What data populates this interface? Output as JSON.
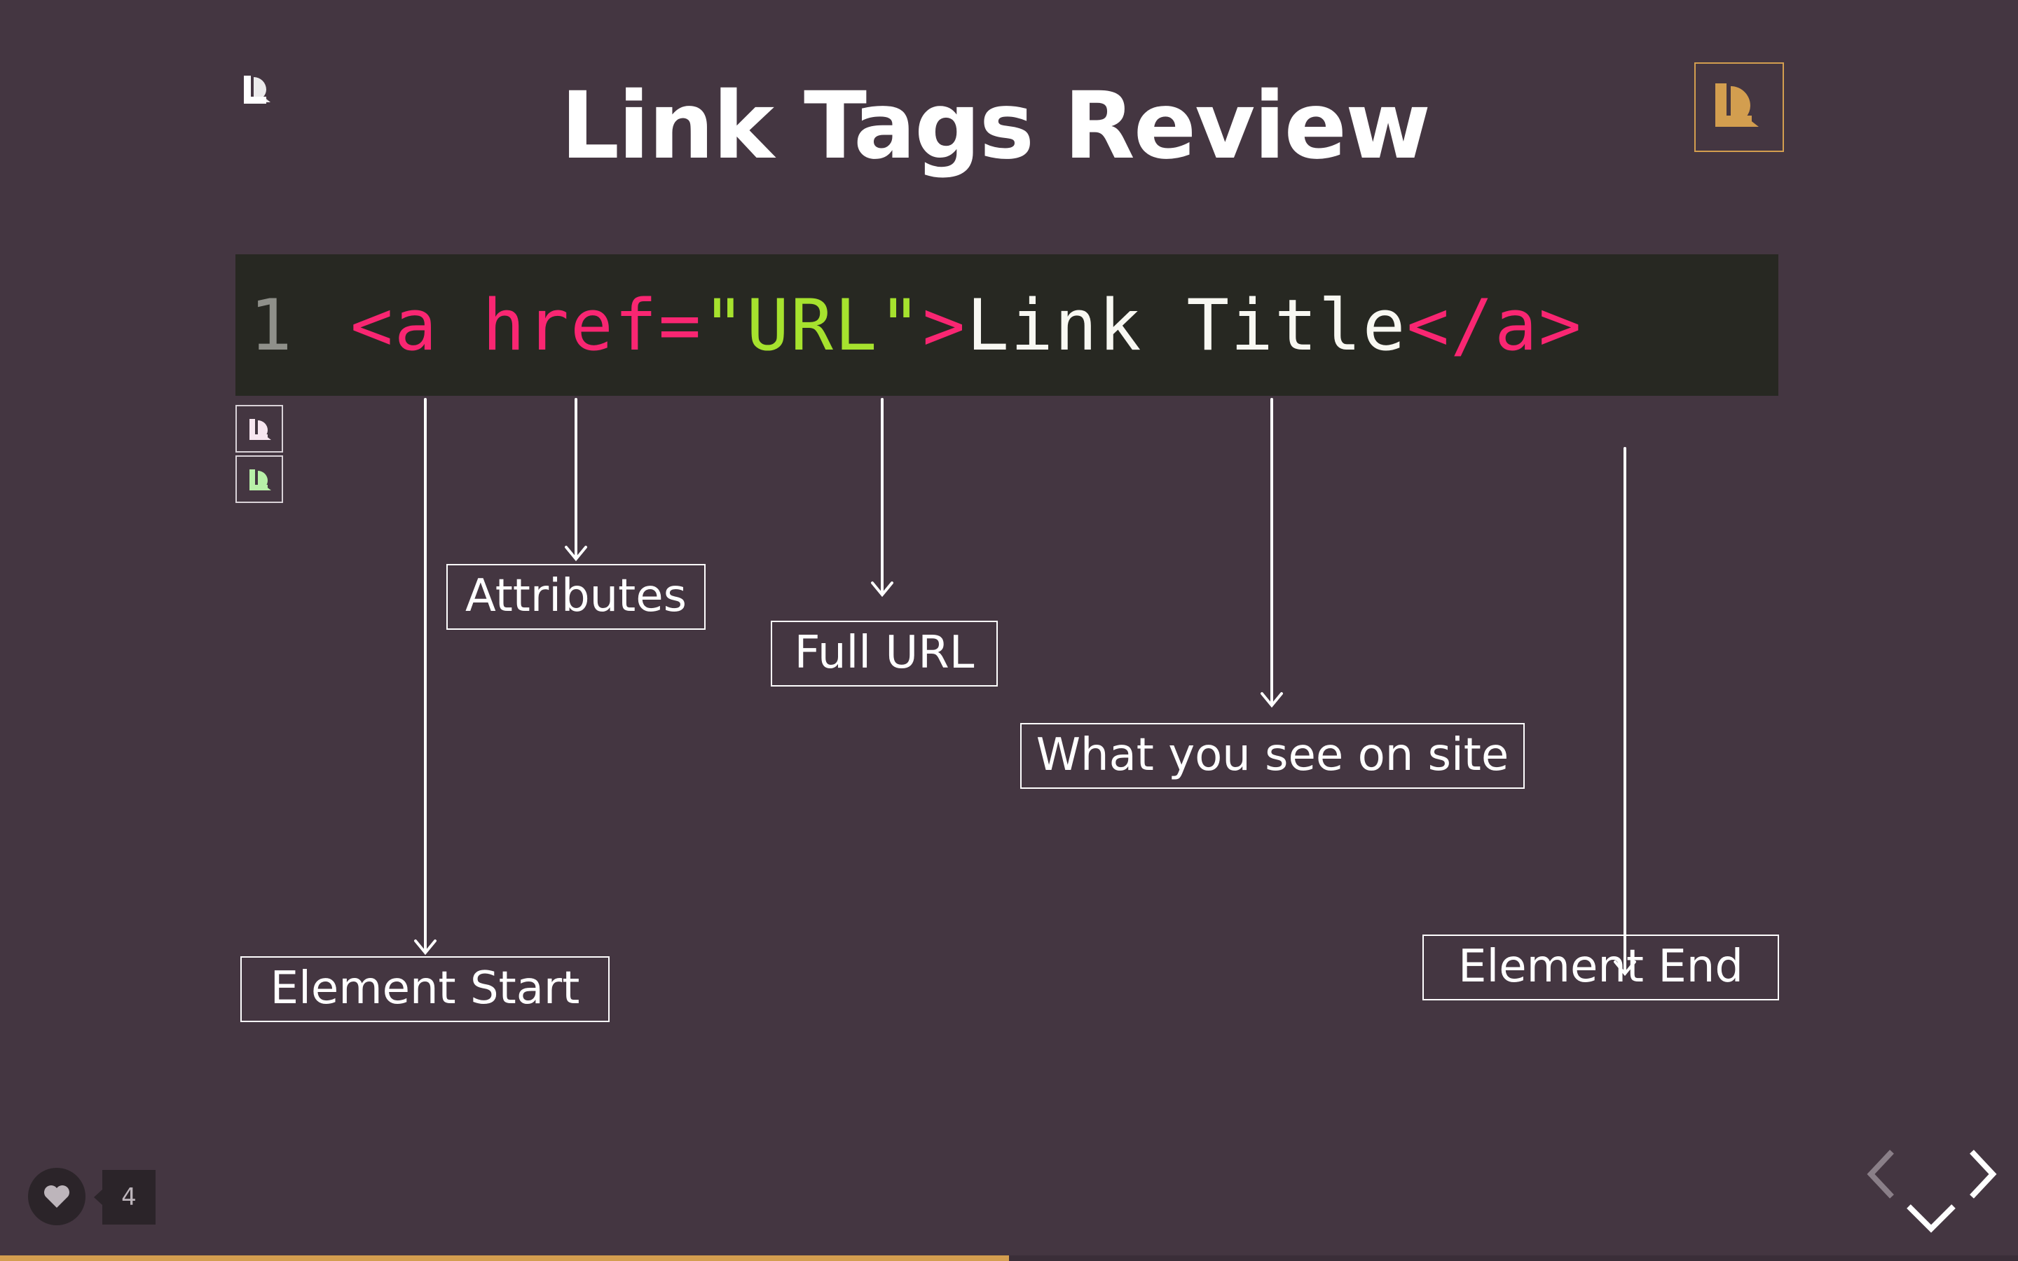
{
  "slide": {
    "title": "Link Tags Review",
    "code": {
      "line_number": "1",
      "tokens": [
        {
          "text": "<a href=",
          "kind": "tag"
        },
        {
          "text": "\"URL\"",
          "kind": "str"
        },
        {
          "text": ">",
          "kind": "tag"
        },
        {
          "text": "Link Title",
          "kind": "txt"
        },
        {
          "text": "</a>",
          "kind": "tag"
        }
      ]
    },
    "annotations": {
      "attributes": "Attributes",
      "full_url": "Full URL",
      "what_you_see": "What you see on site",
      "element_start": "Element Start",
      "element_end": "Element End"
    }
  },
  "likes": {
    "count": "4"
  },
  "progress": {
    "fraction": 0.5
  },
  "colors": {
    "background": "#443641",
    "code_background": "#272822",
    "tag": "#f92672",
    "string": "#a6e22e",
    "text": "#f8f8f2",
    "accent": "#d39e4f"
  },
  "icons": {
    "brand": "brand-logo-icon",
    "like": "heart-icon",
    "prev": "chevron-left-icon",
    "next": "chevron-right-icon",
    "down": "chevron-down-icon"
  }
}
